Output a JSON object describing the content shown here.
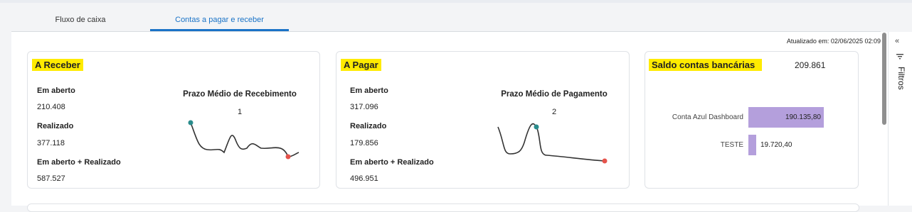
{
  "tabs": [
    {
      "label": "Fluxo de caixa",
      "active": false
    },
    {
      "label": "Contas a pagar e receber",
      "active": true
    }
  ],
  "updated": "Atualizado em: 02/06/2025 02:09",
  "receber": {
    "title": "A Receber",
    "em_aberto_label": "Em aberto",
    "em_aberto_value": "210.408",
    "realizado_label": "Realizado",
    "realizado_value": "377.118",
    "total_label": "Em aberto + Realizado",
    "total_value": "587.527",
    "prazo_title": "Prazo Médio de Recebimento",
    "prazo_value": "1"
  },
  "pagar": {
    "title": "A Pagar",
    "em_aberto_label": "Em aberto",
    "em_aberto_value": "317.096",
    "realizado_label": "Realizado",
    "realizado_value": "179.856",
    "total_label": "Em aberto + Realizado",
    "total_value": "496.951",
    "prazo_title": "Prazo Médio de Pagamento",
    "prazo_value": "2"
  },
  "saldo": {
    "title": "Saldo contas bancárias",
    "total": "209.861",
    "accounts": [
      {
        "name": "Conta Azul Dashboard",
        "value_label": "190.135,80",
        "value": 190135.8
      },
      {
        "name": "TESTE",
        "value_label": "19.720,40",
        "value": 19720.4
      }
    ]
  },
  "sidebar": {
    "collapse_icon": "double-chevron-left-icon",
    "filter_icon": "filter-icon",
    "label": "Filtros"
  },
  "colors": {
    "accent": "#1a73c7",
    "highlight": "#ffeb00",
    "bar": "#b49fdc",
    "spark_start": "#2a8c8c",
    "spark_end": "#e5534b"
  }
}
